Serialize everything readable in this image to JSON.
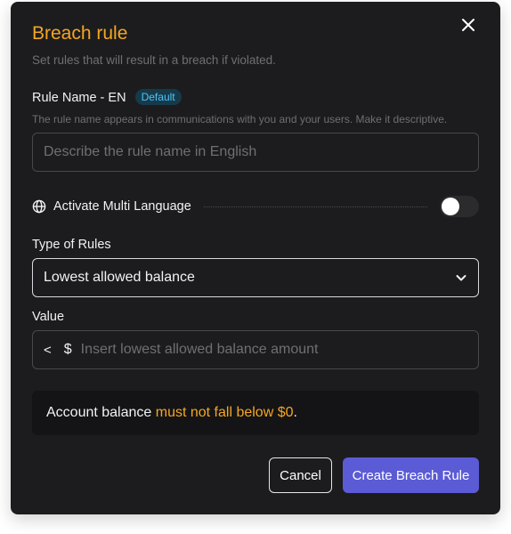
{
  "modal": {
    "title": "Breach rule",
    "subtitle": "Set rules that will result in a breach if violated."
  },
  "rule_name": {
    "label": "Rule Name - EN",
    "badge": "Default",
    "helper": "The rule name appears in communications with you and your users. Make it descriptive.",
    "value": "",
    "placeholder": "Describe the rule name in English"
  },
  "multi_language": {
    "label": "Activate Multi Language",
    "enabled": false,
    "icon": "globe-icon"
  },
  "type_of_rules": {
    "label": "Type of Rules",
    "selected": "Lowest allowed balance",
    "icon": "chevron-down-icon"
  },
  "value_field": {
    "label": "Value",
    "operator": "<",
    "currency": "$",
    "value": "",
    "placeholder": "Insert lowest allowed balance amount"
  },
  "info": {
    "prefix": "Account balance ",
    "highlight": "must not fall below $0",
    "suffix": "."
  },
  "buttons": {
    "cancel": "Cancel",
    "create": "Create Breach Rule"
  },
  "colors": {
    "background": "#1c1c1e",
    "accent": "#f5a623",
    "primary_button": "#5b5bd6",
    "badge_text": "#4fc3f7"
  }
}
